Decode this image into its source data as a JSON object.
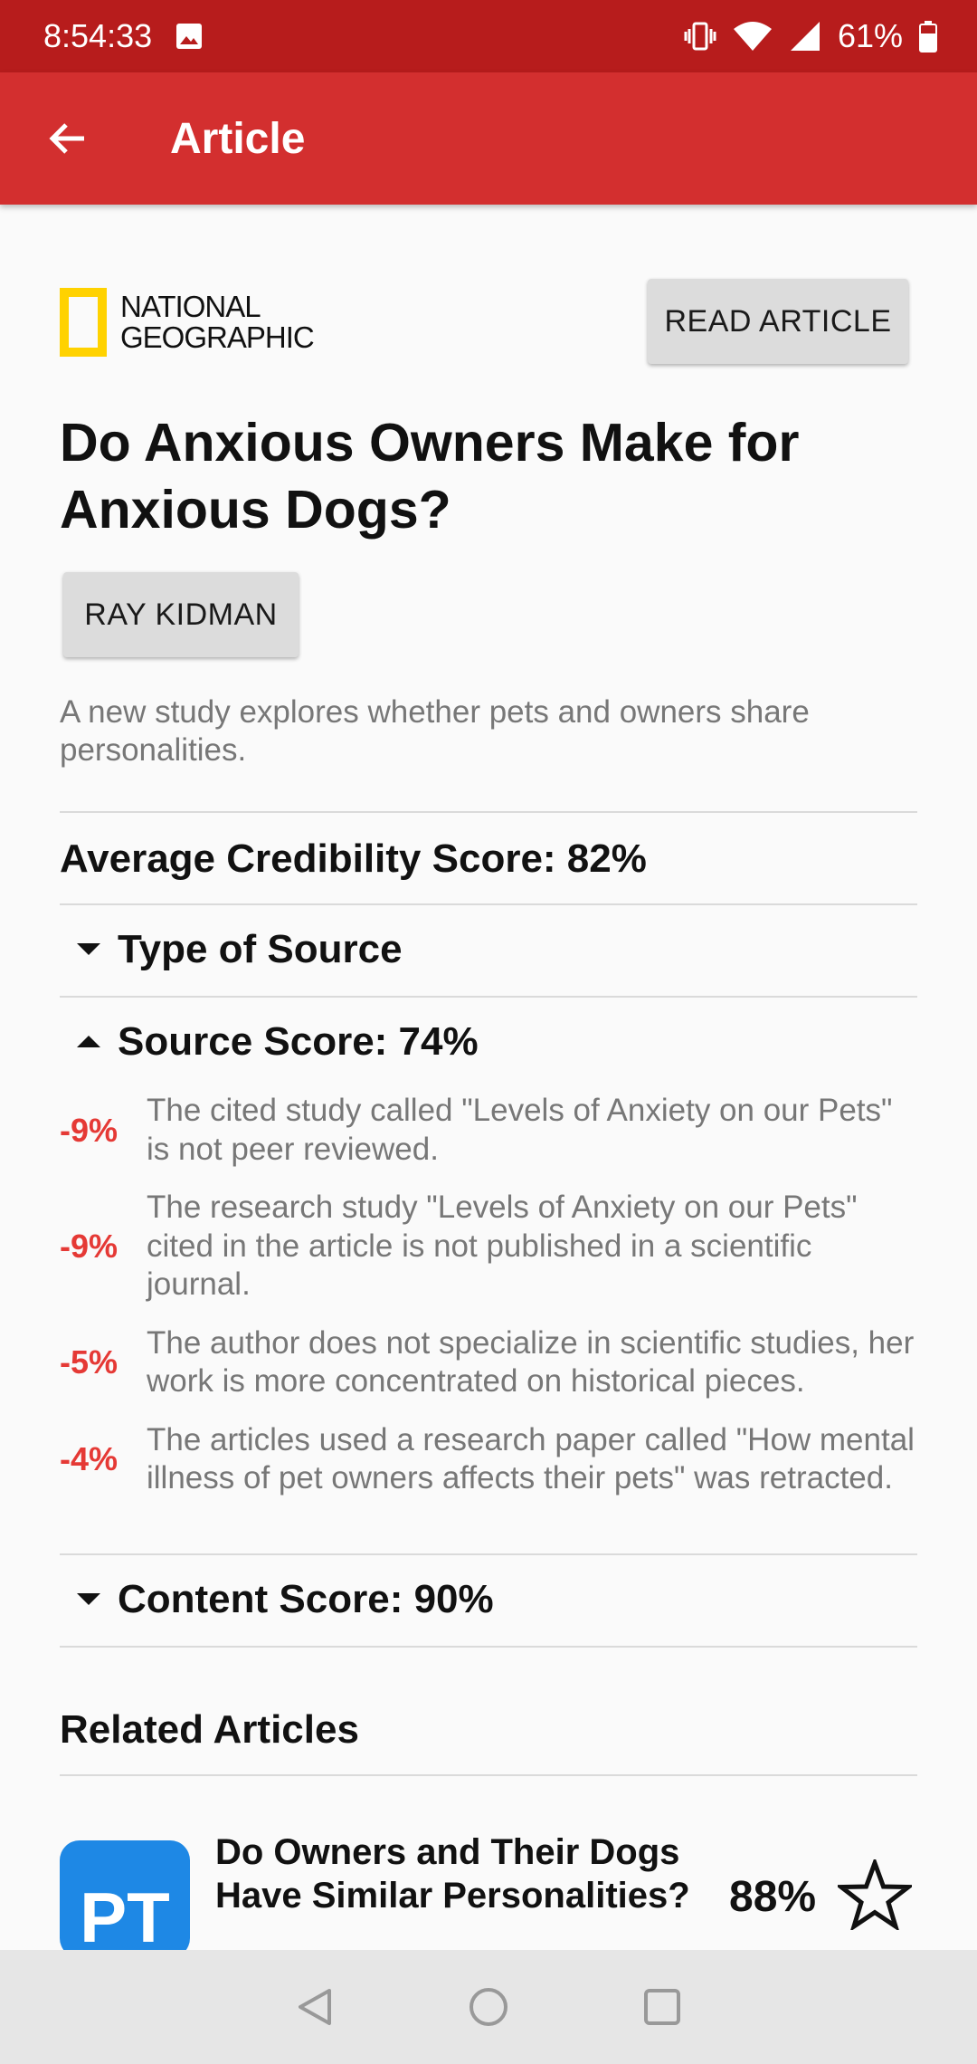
{
  "status_bar": {
    "time": "8:54:33",
    "battery": "61%"
  },
  "app_bar": {
    "title": "Article"
  },
  "article": {
    "source": {
      "line1": "NATIONAL",
      "line2": "GEOGRAPHIC"
    },
    "read_button": "READ ARTICLE",
    "headline": "Do Anxious Owners Make for Anxious Dogs?",
    "author_button": "RAY KIDMAN",
    "summary": "A new study explores whether pets and owners share personalities."
  },
  "credibility": {
    "average": "Average Credibility Score: 82%",
    "sections": [
      {
        "label": "Type of Source",
        "expanded": false
      },
      {
        "label": "Source Score: 74%",
        "expanded": true
      },
      {
        "label": "Content Score: 90%",
        "expanded": false
      }
    ],
    "reasons": [
      {
        "delta": "-9%",
        "text": "The cited study called \"Levels of Anxiety on our Pets\" is not peer reviewed."
      },
      {
        "delta": "-9%",
        "text": "The research study \"Levels of Anxiety on our Pets\" cited in the article is not published in a scientific journal."
      },
      {
        "delta": "-5%",
        "text": "The author does not specialize in scientific studies, her work is more concentrated on historical pieces."
      },
      {
        "delta": "-4%",
        "text": "The articles used a research paper called \"How mental illness of pet owners affects their pets\" was retracted."
      }
    ]
  },
  "related": {
    "heading": "Related Articles",
    "items": [
      {
        "logo": "PT",
        "title": "Do Owners and Their Dogs Have Similar Personalities?",
        "score": "88%"
      }
    ]
  },
  "colors": {
    "status_bar": "#b71c1c",
    "app_bar": "#d32f2f",
    "negative": "#e53935",
    "natgeo_yellow": "#ffd200",
    "pt_blue": "#1e88e5"
  },
  "icons": [
    "image-icon",
    "vibrate-icon",
    "wifi-icon",
    "cell-signal-icon",
    "battery-icon",
    "back-arrow-icon",
    "caret-down-icon",
    "caret-up-icon",
    "star-outline-icon",
    "nav-back-icon",
    "nav-home-icon",
    "nav-recents-icon"
  ]
}
